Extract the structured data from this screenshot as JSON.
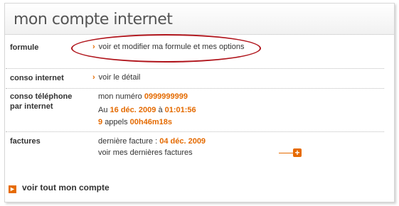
{
  "page": {
    "title": "mon compte internet"
  },
  "rows": {
    "formule": {
      "label": "formule",
      "link": "voir et modifier ma formule et mes options"
    },
    "conso_internet": {
      "label": "conso internet",
      "link": "voir le détail"
    },
    "conso_telephone": {
      "label_line1": "conso téléphone",
      "label_line2": "par internet",
      "numero_prefix": "mon numéro",
      "numero": "0999999999",
      "date_prefix": "Au",
      "date": "16 déc. 2009",
      "time_prefix": "à",
      "time": "01:01:56",
      "calls_count": "9",
      "calls_label": "appels",
      "duration": "00h46m18s"
    },
    "factures": {
      "label": "factures",
      "last_prefix": "dernière facture :",
      "last_date": "04 déc. 2009",
      "see_all": "voir mes dernières factures",
      "expand_symbol": "+"
    }
  },
  "footer": {
    "link": "voir tout mon compte",
    "icon": "arrow-right-icon"
  },
  "colors": {
    "accent": "#e66b00",
    "annotation": "#b0141b"
  }
}
